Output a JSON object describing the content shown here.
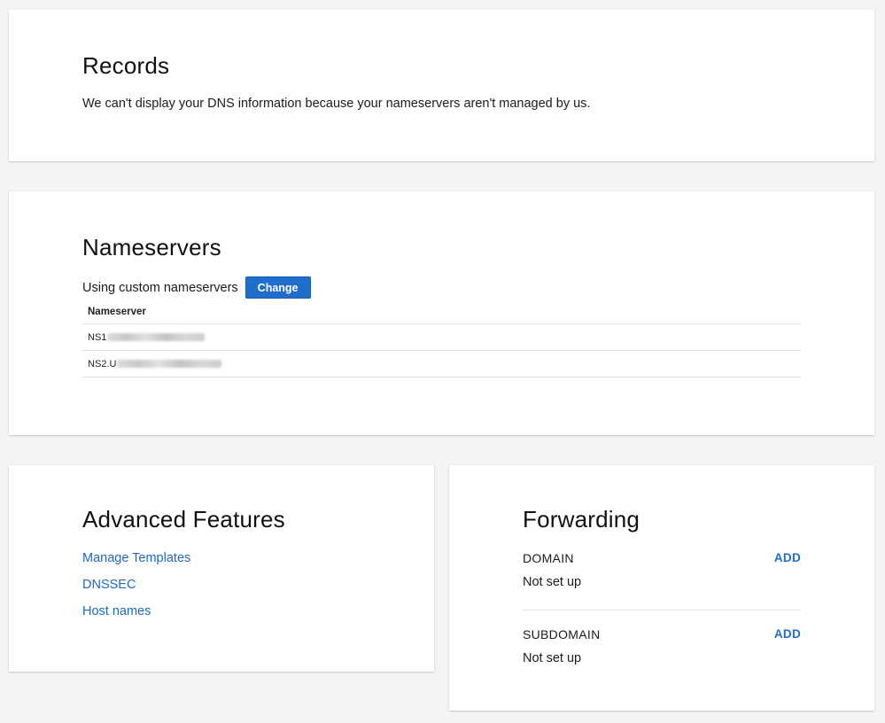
{
  "records": {
    "title": "Records",
    "description": "We can't display your DNS information because your nameservers aren't managed by us."
  },
  "nameservers": {
    "title": "Nameservers",
    "using_text": "Using custom nameservers",
    "change_label": "Change",
    "column_header": "Nameserver",
    "rows": [
      {
        "prefix": "NS1"
      },
      {
        "prefix": "NS2.U"
      }
    ]
  },
  "advanced": {
    "title": "Advanced Features",
    "links": [
      "Manage Templates",
      "DNSSEC",
      "Host names"
    ]
  },
  "forwarding": {
    "title": "Forwarding",
    "items": [
      {
        "label": "DOMAIN",
        "status": "Not set up",
        "action": "ADD"
      },
      {
        "label": "SUBDOMAIN",
        "status": "Not set up",
        "action": "ADD"
      }
    ]
  },
  "colors": {
    "accent": "#1f6ecc",
    "link": "#1a6ac4",
    "background": "#f3f4f6"
  }
}
